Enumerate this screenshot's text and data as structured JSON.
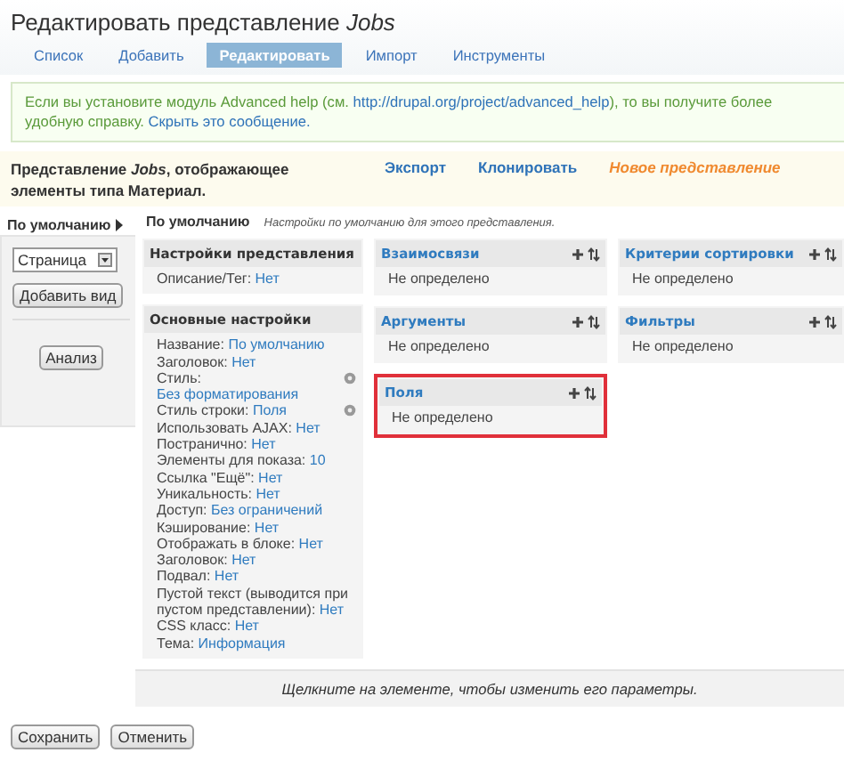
{
  "page_title": "Редактировать представление *Jobs*",
  "tabs": [
    {
      "label": "Список",
      "selected": false
    },
    {
      "label": "Добавить",
      "selected": false
    },
    {
      "label": "Редактировать",
      "selected": true
    },
    {
      "label": "Импорт",
      "selected": false
    },
    {
      "label": "Инструменты",
      "selected": false
    }
  ],
  "message": {
    "text_before": "Если вы установите модуль Advanced help (см. ",
    "link": "http://drupal.org/project/advanced_help",
    "text_after": "), то вы получите более удобную справку. ",
    "hide_link": "Скрыть это сообщение."
  },
  "view_info": {
    "description": "Представление *Jobs*, отображающее элементы типа Материал.",
    "links": [
      {
        "label": "Экспорт",
        "kind": "link"
      },
      {
        "label": "Клонировать",
        "kind": "link"
      },
      {
        "label": "Новое представление",
        "kind": "new"
      }
    ]
  },
  "displays": [
    {
      "label": "По умолчанию",
      "selected": true
    }
  ],
  "display_select": {
    "value": "Страница"
  },
  "add_display_button": "Добавить вид",
  "analyze_button": "Анализ",
  "display_header": {
    "title": "По умолчанию",
    "description": "Настройки по умолчанию для этого представления."
  },
  "columns": [
    [
      {
        "title": "Настройки представления",
        "kind": "plain",
        "highlighted": false,
        "rows": [
          {
            "label": "Описание/Тег:",
            "value": "Нет",
            "configurable": false
          }
        ]
      },
      {
        "title": "Основные настройки",
        "kind": "plain",
        "highlighted": false,
        "rows": [
          {
            "label": "Название:",
            "value": "По умолчанию",
            "configurable": false
          },
          {
            "label": "Заголовок:",
            "value": "Нет",
            "configurable": false
          },
          {
            "label": "Стиль:",
            "value": "Без форматирования",
            "configurable": true
          },
          {
            "label": "Стиль строки:",
            "value": "Поля",
            "configurable": true
          },
          {
            "label": "Использовать AJAX:",
            "value": "Нет",
            "configurable": false
          },
          {
            "label": "Постранично:",
            "value": "Нет",
            "configurable": false
          },
          {
            "label": "Элементы для показа:",
            "value": "10",
            "configurable": false
          },
          {
            "label": "Ссылка \"Ещё\":",
            "value": "Нет",
            "configurable": false
          },
          {
            "label": "Уникальность:",
            "value": "Нет",
            "configurable": false
          },
          {
            "label": "Доступ:",
            "value": "Без ограничений",
            "configurable": false
          },
          {
            "label": "Кэширование:",
            "value": "Нет",
            "configurable": false
          },
          {
            "label": "Отображать в блоке:",
            "value": "Нет",
            "configurable": false
          },
          {
            "label": "Заголовок:",
            "value": "Нет",
            "configurable": false
          },
          {
            "label": "Подвал:",
            "value": "Нет",
            "configurable": false
          },
          {
            "label": "Пустой текст (выводится при пустом представлении):",
            "value": "Нет",
            "configurable": false
          },
          {
            "label": "CSS класс:",
            "value": "Нет",
            "configurable": false
          },
          {
            "label": "Тема:",
            "value": "Информация",
            "configurable": false
          }
        ]
      }
    ],
    [
      {
        "title": "Взаимосвязи",
        "kind": "section",
        "highlighted": false,
        "text": "Не определено"
      },
      {
        "title": "Аргументы",
        "kind": "section",
        "highlighted": false,
        "text": "Не определено"
      },
      {
        "title": "Поля",
        "kind": "section",
        "highlighted": true,
        "text": "Не определено"
      }
    ],
    [
      {
        "title": "Критерии сортировки",
        "kind": "section",
        "highlighted": false,
        "text": "Не определено"
      },
      {
        "title": "Фильтры",
        "kind": "section",
        "highlighted": false,
        "text": "Не определено"
      }
    ]
  ],
  "hint": "Щелкните на элементе, чтобы изменить его параметры.",
  "buttons": [
    "Сохранить",
    "Отменить"
  ]
}
